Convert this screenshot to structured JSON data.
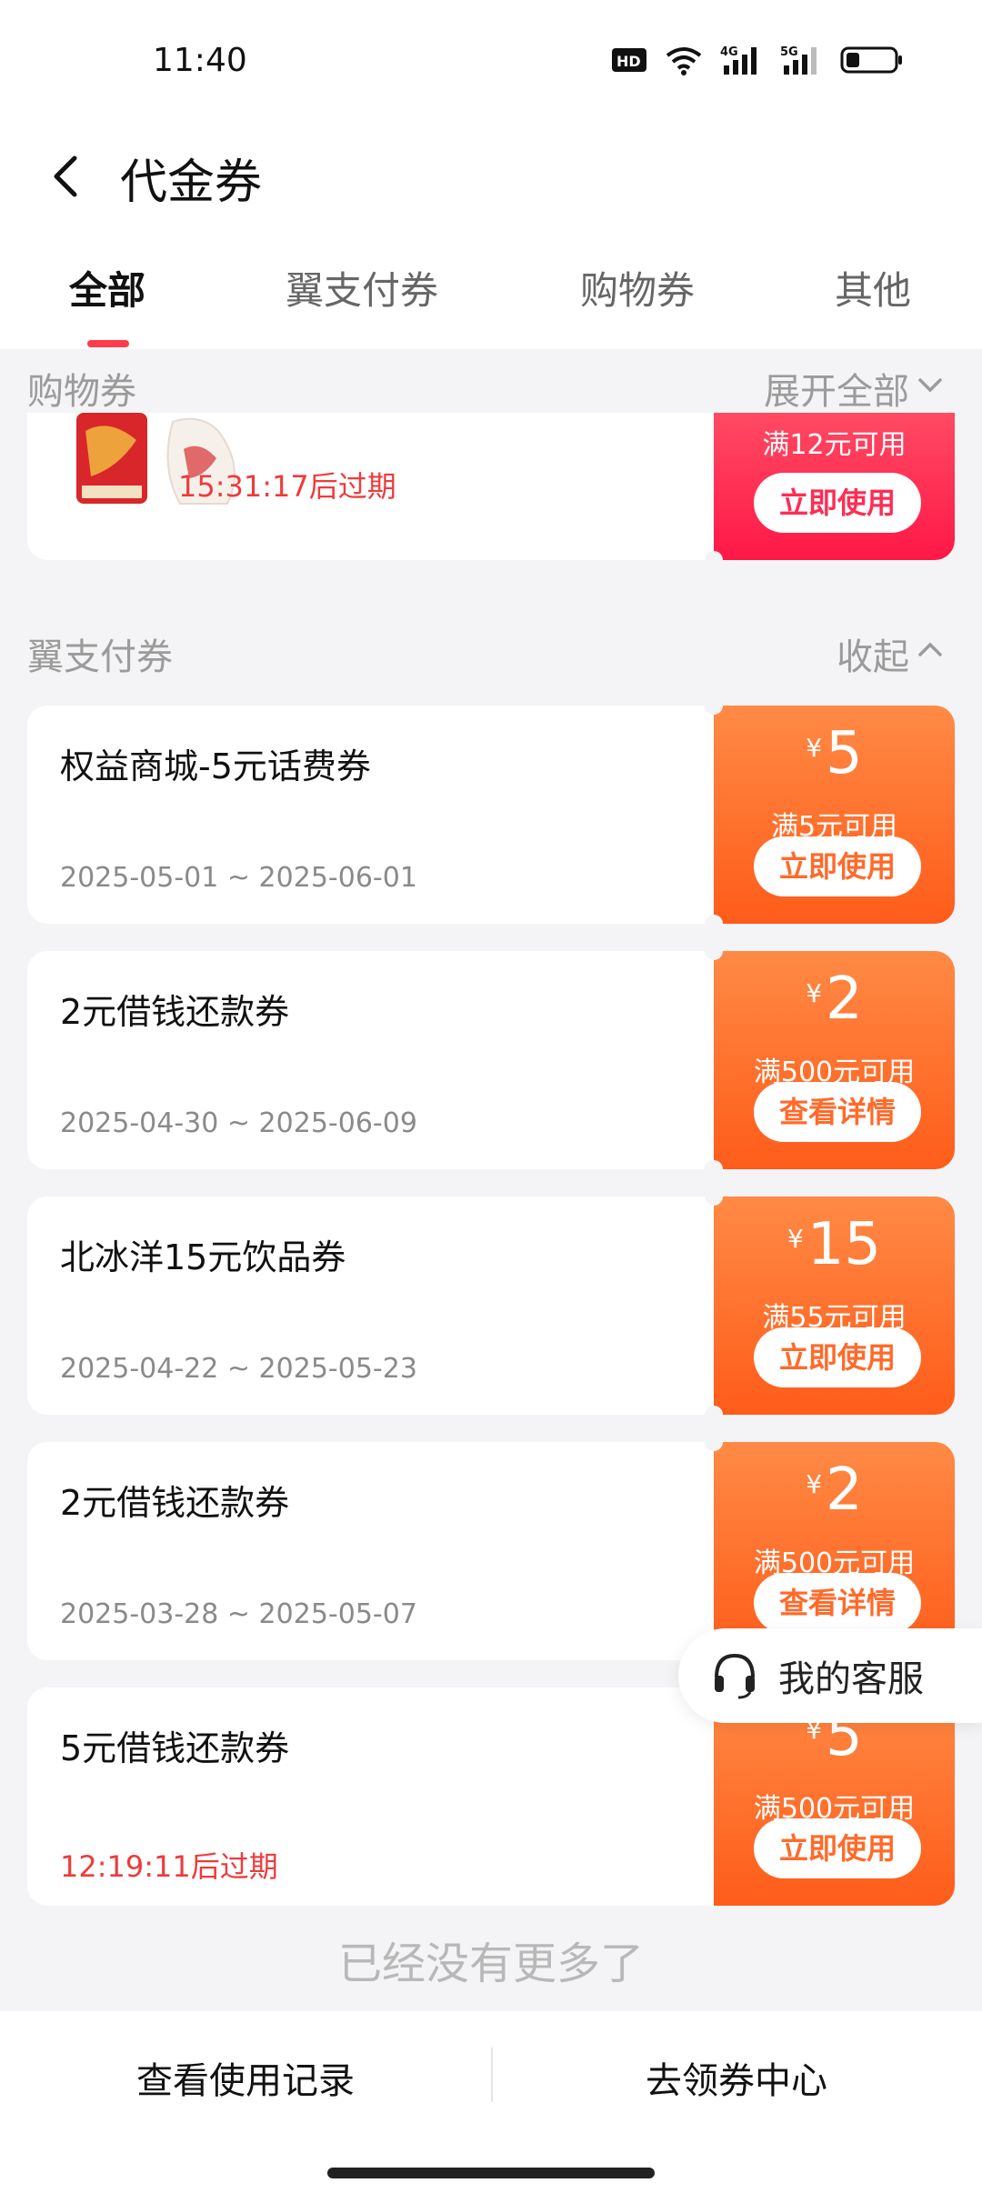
{
  "status_bar": {
    "time": "11:40",
    "network_4g": "4G",
    "network_5g": "5G",
    "hd_label": "HD"
  },
  "nav": {
    "title": "代金券"
  },
  "tabs": [
    {
      "label": "全部",
      "active": true
    },
    {
      "label": "翼支付券",
      "active": false
    },
    {
      "label": "购物券",
      "active": false
    },
    {
      "label": "其他",
      "active": false
    }
  ],
  "sections": {
    "shopping": {
      "title": "购物券",
      "action": "展开全部"
    },
    "yizhifu": {
      "title": "翼支付券",
      "action": "收起"
    }
  },
  "shopping_card": {
    "expire_text": "15:31:17后过期",
    "condition": "满12元可用",
    "button": "立即使用"
  },
  "coupons": [
    {
      "title": "权益商城-5元话费券",
      "date": "2025-05-01 ~ 2025-06-01",
      "yen": "¥",
      "amount": "5",
      "condition": "满5元可用",
      "button": "立即使用"
    },
    {
      "title": "2元借钱还款券",
      "date": "2025-04-30 ~ 2025-06-09",
      "yen": "¥",
      "amount": "2",
      "condition": "满500元可用",
      "button": "查看详情"
    },
    {
      "title": "北冰洋15元饮品券",
      "date": "2025-04-22 ~ 2025-05-23",
      "yen": "¥",
      "amount": "15",
      "condition": "满55元可用",
      "button": "立即使用"
    },
    {
      "title": "2元借钱还款券",
      "date": "2025-03-28 ~ 2025-05-07",
      "yen": "¥",
      "amount": "2",
      "condition": "满500元可用",
      "button": "查看详情"
    },
    {
      "title": "5元借钱还款券",
      "date": "12:19:11后过期",
      "yen": "¥",
      "amount": "5",
      "condition": "满500元可用",
      "button": "立即使用"
    }
  ],
  "footer_text": "已经没有更多了",
  "service": {
    "label": "我的客服"
  },
  "bottom_bar": {
    "left": "查看使用记录",
    "right": "去领券中心"
  },
  "colors": {
    "accent_red": "#ff3b4a",
    "coupon_orange": "#ff6a2a",
    "coupon_pink": "#ff2c53",
    "expire_red": "#ee3b3b"
  }
}
